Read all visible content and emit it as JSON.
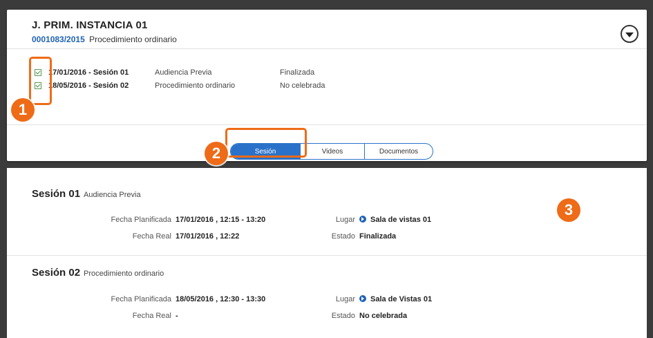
{
  "header": {
    "court_title": "J. PRIM. INSTANCIA 01",
    "case_number": "0001083/2015",
    "case_type": "Procedimiento ordinario"
  },
  "session_list": [
    {
      "date": "17/01/2016 - Sesión 01",
      "type": "Audiencia Previa",
      "state": "Finalizada",
      "checked": true
    },
    {
      "date": "18/05/2016 - Sesión 02",
      "type": "Procedimiento ordinario",
      "state": "No celebrada",
      "checked": true
    }
  ],
  "tabs": [
    {
      "label": "Sesión",
      "active": true
    },
    {
      "label": "Videos",
      "active": false
    },
    {
      "label": "Documentos",
      "active": false
    }
  ],
  "badges": [
    "1",
    "2",
    "3"
  ],
  "details": [
    {
      "title": "Sesión 01",
      "subtitle": "Audiencia Previa",
      "planned_label": "Fecha Planificada",
      "planned_value": "17/01/2016 , 12:15 - 13:20",
      "real_label": "Fecha Real",
      "real_value": "17/01/2016 , 12:22",
      "place_label": "Lugar",
      "place_value": "Sala de vistas 01",
      "state_label": "Estado",
      "state_value": "Finalizada"
    },
    {
      "title": "Sesión 02",
      "subtitle": "Procedimiento ordinario",
      "planned_label": "Fecha Planificada",
      "planned_value": "18/05/2016 , 12:30 - 13:30",
      "real_label": "Fecha Real",
      "real_value": "-",
      "place_label": "Lugar",
      "place_value": "Sala de Vistas 01",
      "state_label": "Estado",
      "state_value": "No celebrada"
    }
  ],
  "colors": {
    "accent": "#2a72c9",
    "highlight": "#ee6b17",
    "link": "#1f62b5"
  },
  "icons": {
    "expand": "chevron-down-circle-icon",
    "place": "play-circle-icon",
    "check": "checkbox-checked-icon"
  }
}
